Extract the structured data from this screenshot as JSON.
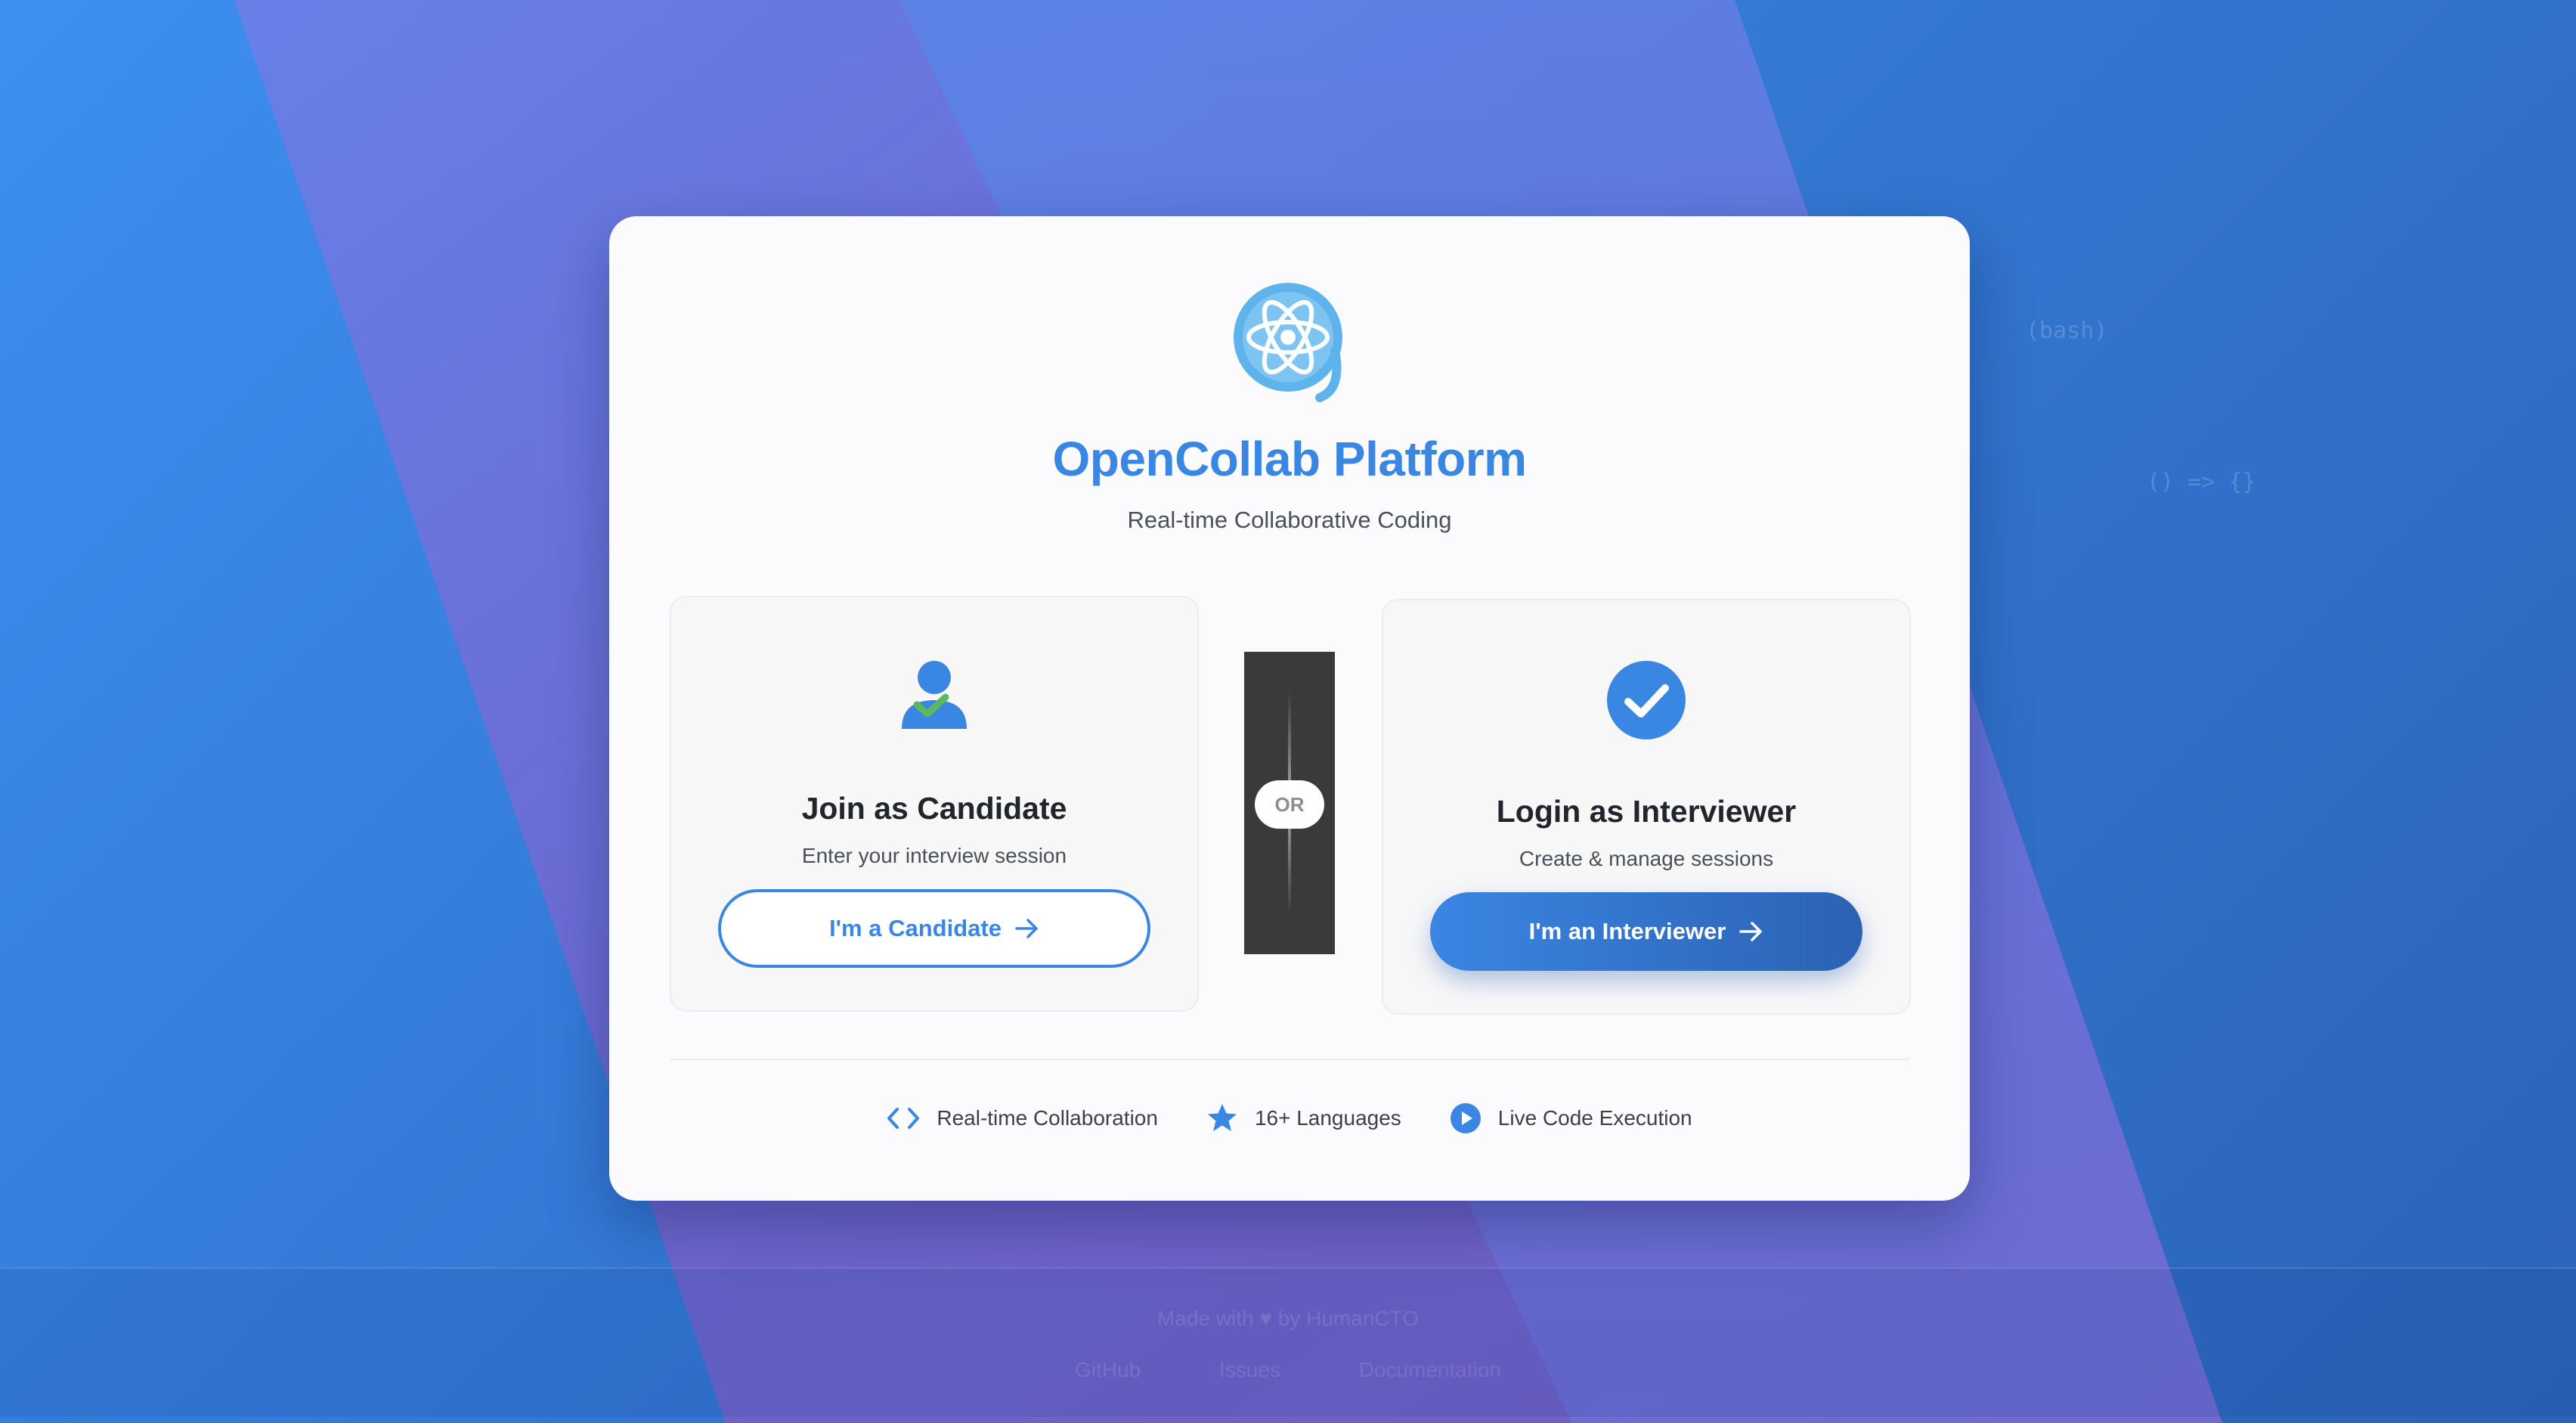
{
  "brand": {
    "title": "OpenCollab Platform",
    "subtitle": "Real-time Collaborative Coding",
    "logo_icon": "atom-logo-icon",
    "accent_color": "#3a86e3"
  },
  "options": {
    "candidate": {
      "icon": "user-check-icon",
      "title": "Join as Candidate",
      "description": "Enter your interview session",
      "button_label": "I'm a Candidate"
    },
    "divider": {
      "label": "OR"
    },
    "interviewer": {
      "icon": "check-circle-icon",
      "title": "Login as Interviewer",
      "description": "Create & manage sessions",
      "button_label": "I'm an Interviewer"
    }
  },
  "features": [
    {
      "icon": "code-brackets-icon",
      "label": "Real-time Collaboration"
    },
    {
      "icon": "star-icon",
      "label": "16+ Languages"
    },
    {
      "icon": "play-circle-icon",
      "label": "Live Code Execution"
    }
  ],
  "footer": {
    "made_with": "Made with ♥ by HumanCTO",
    "links": [
      "GitHub",
      "Issues",
      "Documentation"
    ]
  },
  "background": {
    "ghost_texts": [
      "(bash)",
      "() => {}"
    ]
  }
}
